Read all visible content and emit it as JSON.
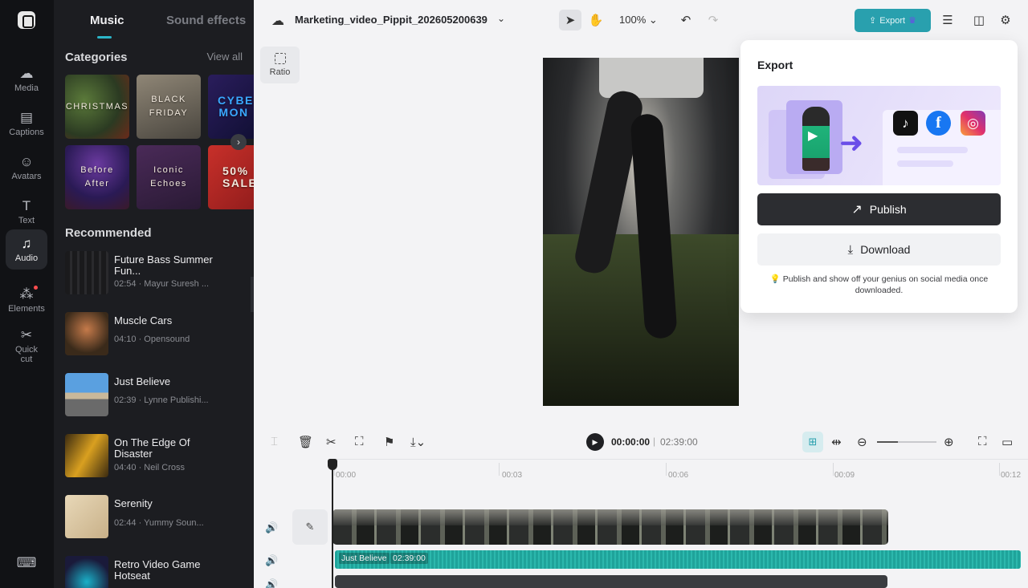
{
  "rail": {
    "items": [
      {
        "label": "Media",
        "icon": "cloud-upload-icon",
        "glyph": "☁"
      },
      {
        "label": "Captions",
        "icon": "captions-icon",
        "glyph": "▤"
      },
      {
        "label": "Avatars",
        "icon": "avatar-icon",
        "glyph": "☺"
      },
      {
        "label": "Text",
        "icon": "text-icon",
        "glyph": "T"
      },
      {
        "label": "Audio",
        "icon": "music-note-icon",
        "glyph": "♫"
      },
      {
        "label": "Elements",
        "icon": "elements-icon",
        "glyph": "⁂"
      },
      {
        "label": "Quick cut",
        "icon": "quick-cut-icon",
        "glyph": "✂"
      }
    ],
    "bottom_icon": "keyboard-icon",
    "bottom_glyph": "⌨"
  },
  "panel": {
    "tab_music": "Music",
    "tab_sound_effects": "Sound effects",
    "categories_title": "Categories",
    "view_all": "View all",
    "categories": [
      {
        "label": "CHRISTMAS"
      },
      {
        "label": "BLACK FRIDAY"
      },
      {
        "label": "CYBER MON"
      },
      {
        "label": "Before After"
      },
      {
        "label": "Iconic Echoes"
      },
      {
        "label": "50% SALE"
      }
    ],
    "recommended_title": "Recommended",
    "recommended": [
      {
        "name": "Future Bass Summer Fun...",
        "meta": "02:54 · Mayur Suresh ..."
      },
      {
        "name": "Muscle Cars",
        "meta": "04:10 · Opensound"
      },
      {
        "name": "Just Believe",
        "meta": "02:39 · Lynne Publishi..."
      },
      {
        "name": "On The Edge Of Disaster",
        "meta": "04:40 · Neil Cross"
      },
      {
        "name": "Serenity",
        "meta": "02:44 · Yummy Soun..."
      },
      {
        "name": "Retro Video Game Hotseat",
        "meta": ""
      }
    ]
  },
  "topbar": {
    "project_name": "Marketing_video_Pippit_202605200639",
    "zoom": "100%",
    "zoom_chevron": "⌄",
    "export_label": "Export"
  },
  "canvas": {
    "ratio_label": "Ratio"
  },
  "export_popover": {
    "title": "Export",
    "publish_label": "Publish",
    "download_label": "Download",
    "tip": "Publish and show off your genius on social media once downloaded.",
    "socials": [
      "TikTok",
      "Facebook",
      "Instagram"
    ]
  },
  "timeline": {
    "current_time": "00:00:00",
    "separator": "|",
    "total_time": "02:39:00",
    "ticks": [
      "00:00",
      "00:03",
      "00:06",
      "00:09",
      "00:12"
    ],
    "audio_clip_name": "Just Believe",
    "audio_clip_duration": "02:39:00"
  },
  "colors": {
    "accent": "#29a0ae",
    "rail_bg": "#111215",
    "panel_bg": "#1c1d21",
    "publish_bg": "#2c2d31"
  }
}
